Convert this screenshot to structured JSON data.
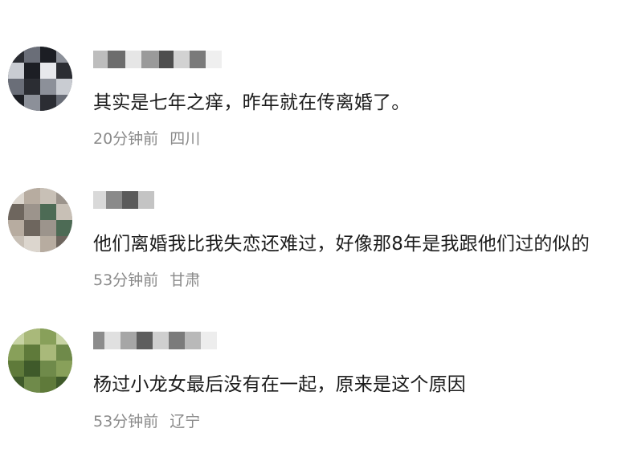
{
  "comments": [
    {
      "username": "",
      "text": "其实是七年之痒，昨年就在传离婚了。",
      "time": "20分钟前",
      "location": "四川",
      "avatar_colors": [
        "#2b2d33",
        "#6a6e78",
        "#c9ccd2",
        "#1c1e24",
        "#8c9099",
        "#e7e8ec"
      ]
    },
    {
      "username": "",
      "text": "他们离婚我比我失恋还难过，好像那8年是我跟他们过的似的",
      "time": "53分钟前",
      "location": "甘肃",
      "avatar_colors": [
        "#9c948c",
        "#6e665e",
        "#c8c0b6",
        "#4d6b55",
        "#b7aca0",
        "#dcd6ce"
      ]
    },
    {
      "username": "",
      "text": "杨过小龙女最后没有在一起，原来是这个原因",
      "time": "53分钟前",
      "location": "辽宁",
      "avatar_colors": [
        "#5f7a3a",
        "#88a05a",
        "#3f5a2a",
        "#a9b97a",
        "#6f8a4a",
        "#c7d3a3"
      ]
    }
  ]
}
